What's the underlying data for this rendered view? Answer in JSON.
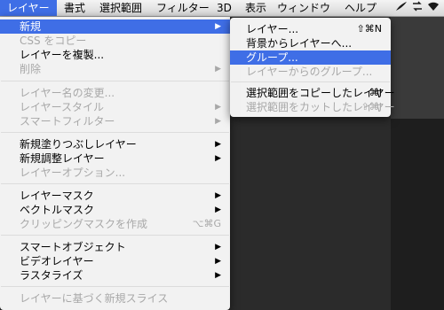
{
  "menubar": {
    "items": [
      {
        "label": "レイヤー",
        "active": true
      },
      {
        "label": "書式"
      },
      {
        "label": "選択範囲"
      },
      {
        "label": "フィルター"
      },
      {
        "label": "3D"
      },
      {
        "label": "表示"
      },
      {
        "label": "ウィンドウ"
      },
      {
        "label": "ヘルプ"
      }
    ],
    "status_icons": [
      "feather-icon",
      "arrows-icon",
      "wifi-icon"
    ]
  },
  "main_menu": {
    "items": [
      {
        "label": "新規",
        "submenu": true,
        "highlighted": true
      },
      {
        "label": "CSS をコピー",
        "disabled": true
      },
      {
        "label": "レイヤーを複製..."
      },
      {
        "label": "削除",
        "submenu": true,
        "disabled": true
      },
      {
        "label": "レイヤー名の変更...",
        "disabled": true
      },
      {
        "label": "レイヤースタイル",
        "submenu": true,
        "disabled": true
      },
      {
        "label": "スマートフィルター",
        "submenu": true,
        "disabled": true
      },
      {
        "label": "新規塗りつぶしレイヤー",
        "submenu": true
      },
      {
        "label": "新規調整レイヤー",
        "submenu": true
      },
      {
        "label": "レイヤーオプション...",
        "disabled": true
      },
      {
        "label": "レイヤーマスク",
        "submenu": true
      },
      {
        "label": "ベクトルマスク",
        "submenu": true
      },
      {
        "label": "クリッピングマスクを作成",
        "disabled": true,
        "shortcut": "⌥⌘G"
      },
      {
        "label": "スマートオブジェクト",
        "submenu": true
      },
      {
        "label": "ビデオレイヤー",
        "submenu": true
      },
      {
        "label": "ラスタライズ",
        "submenu": true
      },
      {
        "label": "レイヤーに基づく新規スライス",
        "disabled": true
      }
    ]
  },
  "submenu": {
    "items": [
      {
        "label": "レイヤー...",
        "shortcut": "⇧⌘N"
      },
      {
        "label": "背景からレイヤーへ..."
      },
      {
        "label": "グループ...",
        "highlighted": true
      },
      {
        "label": "レイヤーからのグループ...",
        "disabled": true
      },
      {
        "label": "選択範囲をコピーしたレイヤー",
        "shortcut": "⌘J"
      },
      {
        "label": "選択範囲をカットしたレイヤー",
        "shortcut": "⇧⌘J",
        "disabled": true
      }
    ]
  },
  "colors": {
    "highlight": "#3f6ee6",
    "disabled_text": "#a8a8a8"
  }
}
